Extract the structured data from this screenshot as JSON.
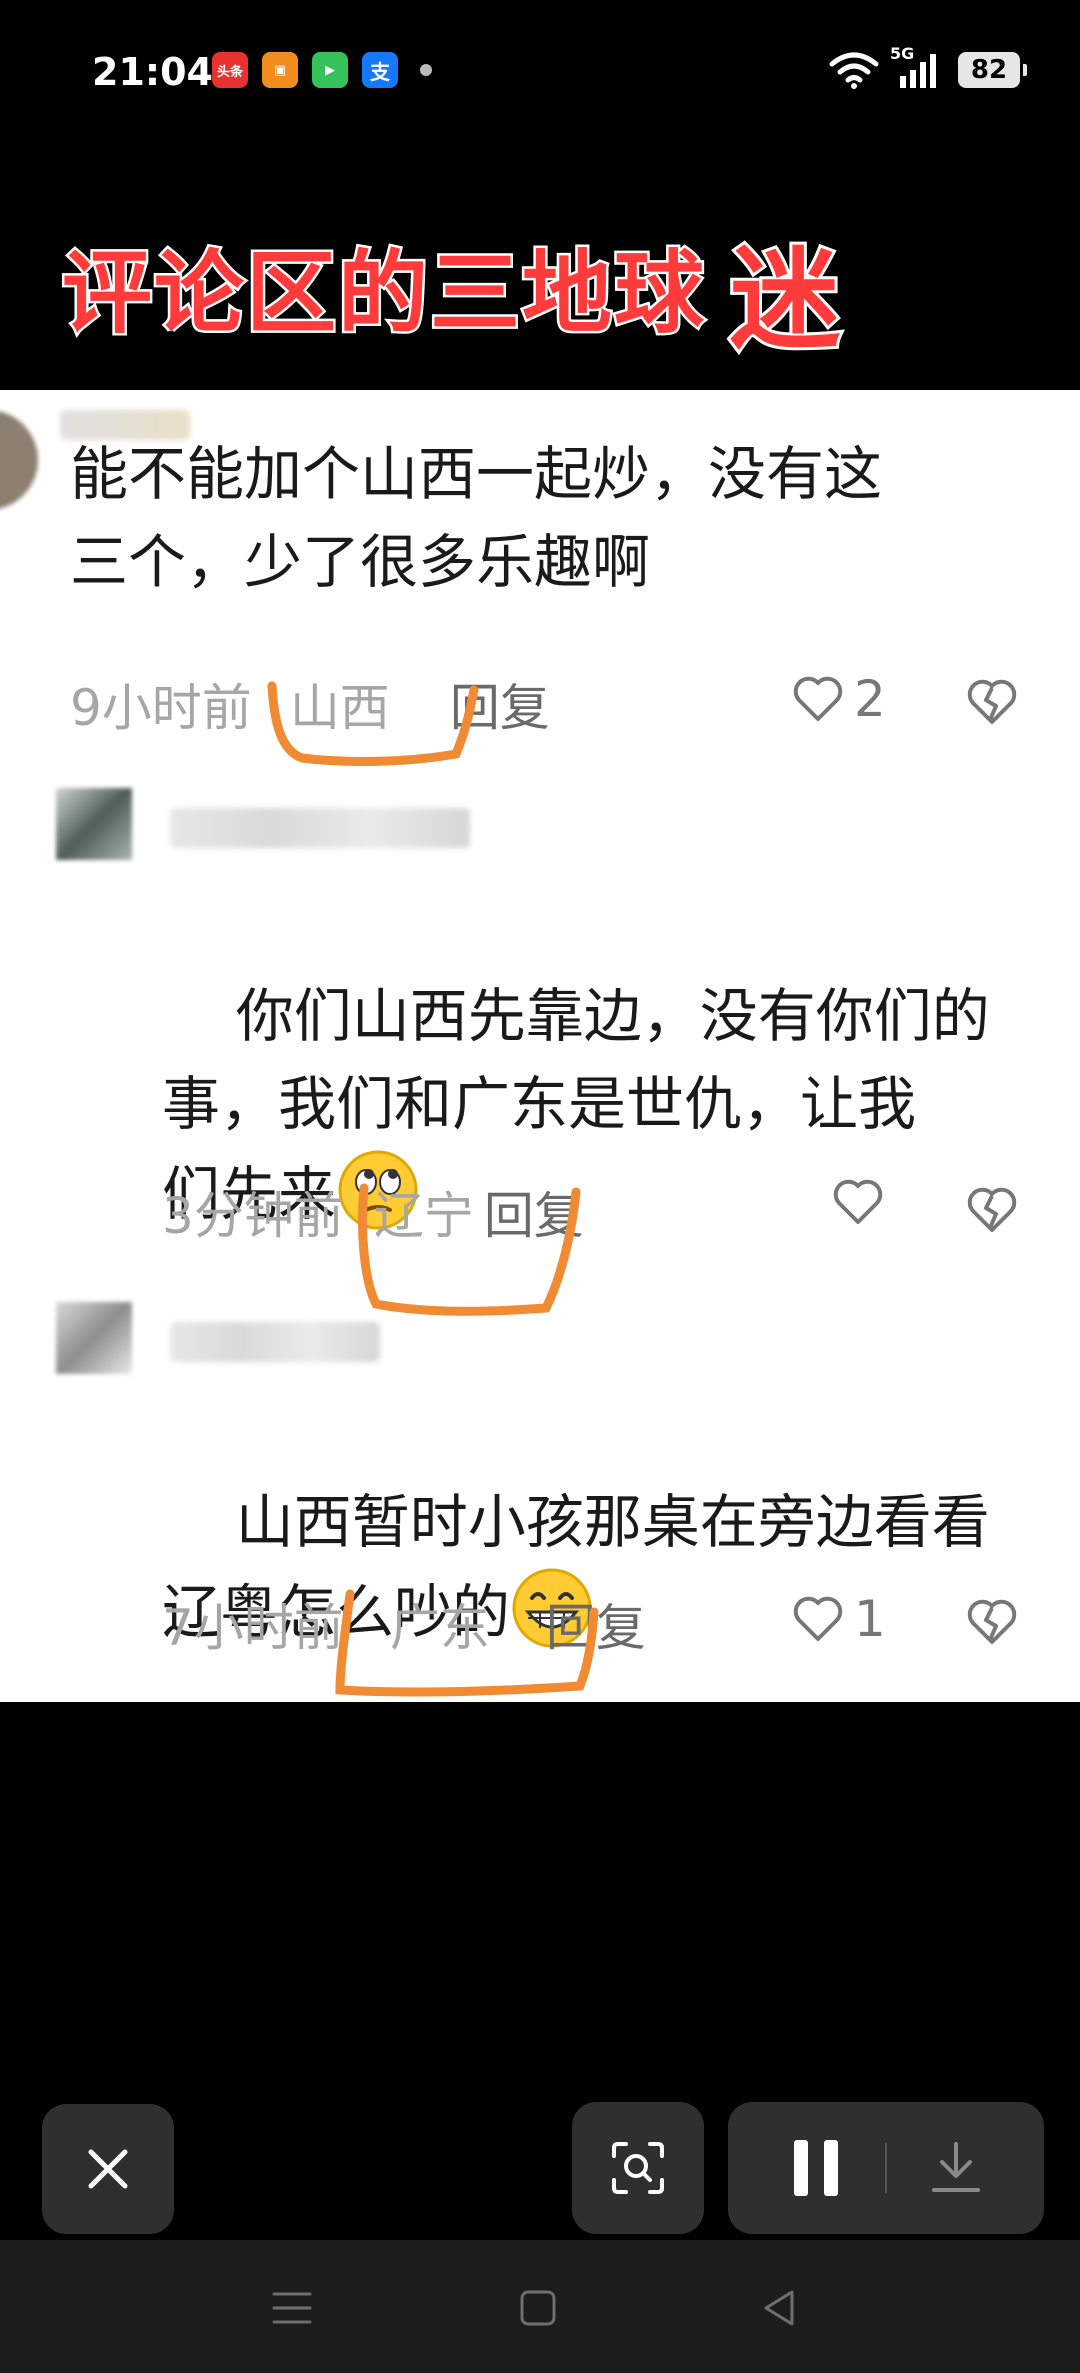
{
  "status_bar": {
    "time": "21:04",
    "apps": [
      {
        "icon": "toutiao-icon",
        "label": "头条",
        "color": "#e8322e"
      },
      {
        "icon": "video-app-icon",
        "label": "▣",
        "color": "#f28c1f"
      },
      {
        "icon": "media-app-icon",
        "label": "▶",
        "color": "#36c25a"
      },
      {
        "icon": "alipay-icon",
        "label": "支",
        "color": "#1677ff"
      }
    ],
    "network": "5G",
    "battery": "82"
  },
  "banner": {
    "title": "评论区的三地球",
    "title_highlight": "迷"
  },
  "comments": [
    {
      "text": "能不能加个山西一起炒，没有这\n三个，少了很多乐趣啊",
      "time": "9小时前",
      "location": "山西",
      "reply": "回复",
      "likes": "2"
    },
    {
      "text": "你们山西先靠边，没有你们的\n事，我们和广东是世仇，让我\n们先来",
      "time": "3分钟前",
      "location": "辽宁",
      "reply": "回复",
      "likes": ""
    },
    {
      "text": "山西暂时小孩那桌在旁边看看\n辽粤怎么吵的",
      "time": "7小时前",
      "location": "广东",
      "reply": "回复",
      "likes": "1"
    }
  ],
  "colors": {
    "banner_red": "#ff3b3b",
    "annotation_orange": "#f08a33",
    "panel_bg": "#ffffff"
  }
}
